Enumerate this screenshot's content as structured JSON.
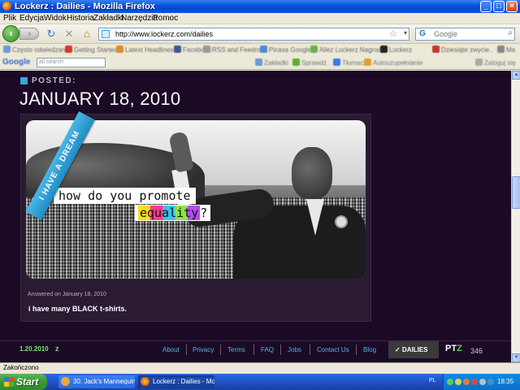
{
  "window": {
    "title": "Lockerz : Dailies - Mozilla Firefox",
    "minimize": "_",
    "maximize": "□",
    "close": "×"
  },
  "menu": [
    "Plik",
    "Edycja",
    "Widok",
    "Historia",
    "Zakładki",
    "Narzędzia",
    "Pomoc"
  ],
  "nav": {
    "back": "‹",
    "forward": "›",
    "url": "http://www.lockerz.com/dailies",
    "search_placeholder": "Google",
    "search_logo": "G"
  },
  "bookmarks": [
    "Często odwiedzane",
    "Getting Started",
    "Latest Headlines",
    "Facebook",
    "RSS and Feedroll",
    "Picasa Google",
    "Allez Lockerz Nagrody",
    "Lockerz",
    "Dziesiąte zwycie..",
    "Ma"
  ],
  "google_toolbar": {
    "logo": "Google",
    "search_placeholder": "all search",
    "tools": [
      "Zakładki",
      "Sprawdź",
      "Tłumacz",
      "Autouzupełnianie",
      "Zaloguj się"
    ]
  },
  "page": {
    "posted_label": "POSTED:",
    "post_date": "JANUARY 18, 2010",
    "sash_text": "I HAVE A DREAM",
    "question_line1": "how do you promote",
    "question_word": "equality",
    "question_mark": "?",
    "answered_on": "Answered on January 18, 2010",
    "answer_text": "i have many BLACK t-shirts."
  },
  "footer": {
    "date": "1.20.2010",
    "date_icon": "z",
    "links": [
      "About",
      "Privacy",
      "Terms",
      "FAQ",
      "Jobs",
      "Contact Us",
      "Blog"
    ],
    "dailies_tab": "✓ DAILIES",
    "ptz_label": "PT",
    "ptz_z": "Z",
    "ptz_count": "346"
  },
  "status": {
    "text": "Zakończono"
  },
  "taskbar": {
    "start": "Start",
    "items": [
      "30. Jack's Mannequin...",
      "Lockerz : Dailies - Mo..."
    ],
    "lang": "PL",
    "clock": "18:35"
  }
}
